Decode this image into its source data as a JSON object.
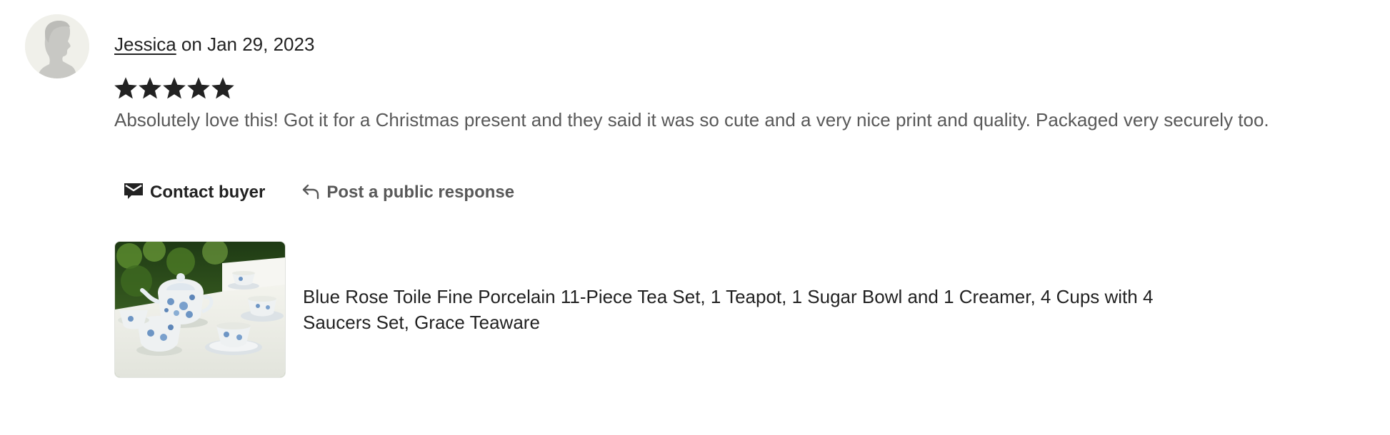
{
  "review": {
    "reviewer_name": "Jessica",
    "date_text": " on Jan 29, 2023",
    "rating": 5,
    "rating_max": 5,
    "text": "Absolutely love this! Got it for a Christmas present and they said it was so cute and a very nice print and quality. Packaged very securely too."
  },
  "actions": {
    "contact_label": "Contact buyer",
    "respond_label": "Post a public response"
  },
  "product": {
    "title": "Blue Rose Toile Fine Porcelain 11-Piece Tea Set, 1 Teapot, 1 Sugar Bowl and 1 Creamer, 4 Cups with 4 Saucers Set, Grace Teaware"
  },
  "icons": {
    "avatar": "default-avatar-silhouette-icon",
    "star": "star-filled-icon",
    "contact": "envelope-icon",
    "respond": "reply-arrow-icon"
  },
  "colors": {
    "text": "#222222",
    "muted_text": "#595959",
    "star": "#222222",
    "avatar_bg": "#f0f0ea",
    "avatar_silhouette": "#c8c8c4"
  }
}
